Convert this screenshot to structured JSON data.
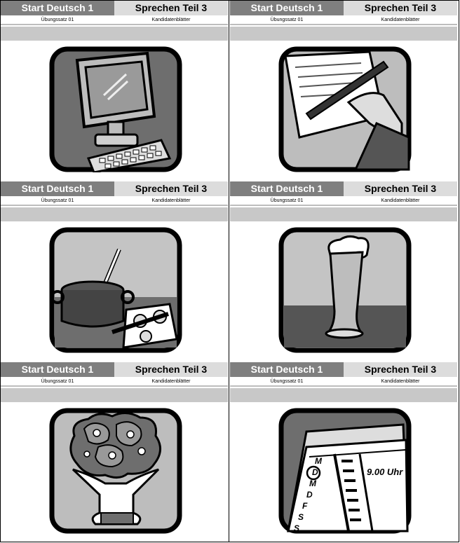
{
  "cards": [
    {
      "header_left": "Start Deutsch 1",
      "header_right": "Sprechen Teil 3",
      "sub_left": "Übungssatz 01",
      "sub_right": "Kandidatenblätter",
      "picture": "computer-icon"
    },
    {
      "header_left": "Start Deutsch 1",
      "header_right": "Sprechen Teil 3",
      "sub_left": "Übungssatz 01",
      "sub_right": "Kandidatenblätter",
      "picture": "writing-letter-icon"
    },
    {
      "header_left": "Start Deutsch 1",
      "header_right": "Sprechen Teil 3",
      "sub_left": "Übungssatz 01",
      "sub_right": "Kandidatenblätter",
      "picture": "cooking-pot-icon"
    },
    {
      "header_left": "Start Deutsch 1",
      "header_right": "Sprechen Teil 3",
      "sub_left": "Übungssatz 01",
      "sub_right": "Kandidatenblätter",
      "picture": "beer-glass-icon"
    },
    {
      "header_left": "Start Deutsch 1",
      "header_right": "Sprechen Teil 3",
      "sub_left": "Übungssatz 01",
      "sub_right": "Kandidatenblätter",
      "picture": "flower-bouquet-icon"
    },
    {
      "header_left": "Start Deutsch 1",
      "header_right": "Sprechen Teil 3",
      "sub_left": "Übungssatz 01",
      "sub_right": "Kandidatenblätter",
      "picture": "calendar-icon",
      "calendar": {
        "days": [
          "M",
          "D",
          "M",
          "D",
          "F",
          "S",
          "S"
        ],
        "time_label": "9.00 Uhr"
      }
    }
  ]
}
